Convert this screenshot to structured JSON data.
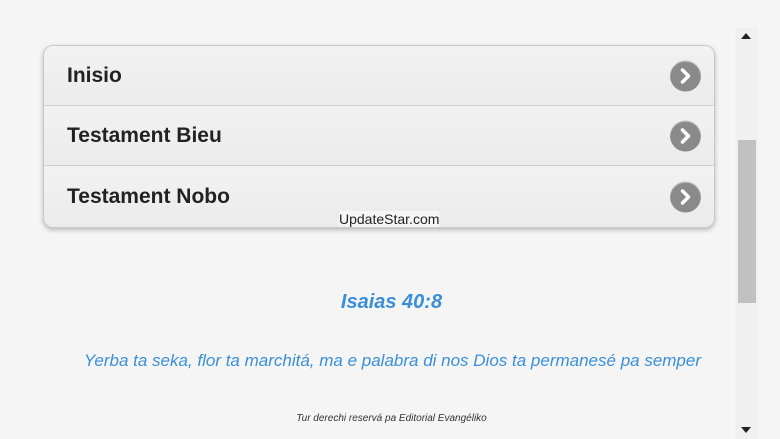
{
  "menu": {
    "items": [
      {
        "label": "Inisio"
      },
      {
        "label": "Testament Bieu"
      },
      {
        "label": "Testament Nobo"
      }
    ]
  },
  "watermark": "UpdateStar.com",
  "verse": {
    "reference": "Isaias 40:8",
    "text": "Yerba ta seka, flor ta marchitá, ma e palabra di nos Dios ta permanesé pa semper"
  },
  "footer": "Tur derechi reservá pa Editorial Evangéliko",
  "colors": {
    "accent": "#3a8fd8",
    "arrow_button": "#8a8a8a",
    "background": "#f5f5f5"
  },
  "icons": {
    "menu_arrow": "chevron-right-circle-icon",
    "scroll_up": "triangle-up-icon",
    "scroll_down": "triangle-down-icon"
  }
}
